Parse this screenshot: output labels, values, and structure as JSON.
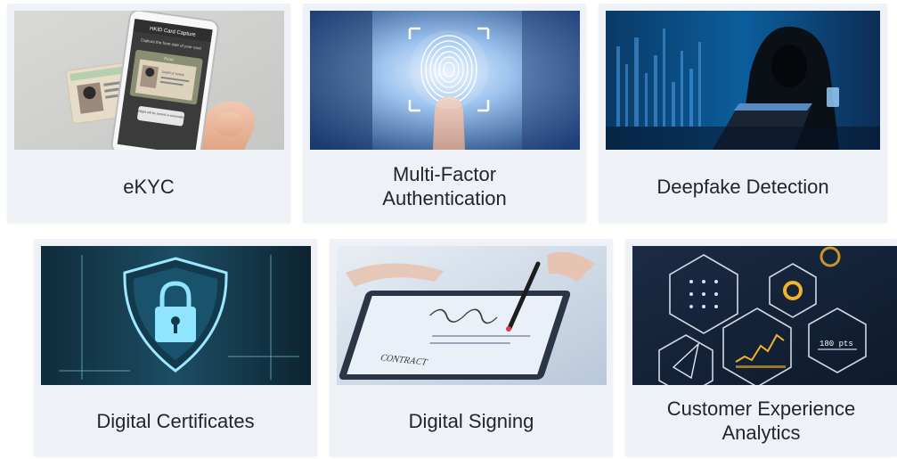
{
  "cards": [
    {
      "title": "eKYC",
      "image": "phone-id-card-capture-image",
      "mock": {
        "screen_title": "HKID Card Capture",
        "screen_hint": "Capture the front side of your card",
        "screen_tag": "Front",
        "screen_btn": "Highlight will be turned in automatically",
        "card_name": "SAMPLE NAME"
      }
    },
    {
      "title": "Multi-Factor\nAuthentication",
      "image": "fingerprint-scan-image"
    },
    {
      "title": "Deepfake Detection",
      "image": "hooded-hacker-laptop-image"
    },
    {
      "title": "Digital Certificates",
      "image": "padlock-shield-image"
    },
    {
      "title": "Digital Signing",
      "image": "contract-tablet-signing-image",
      "mock": {
        "doc_text": "CONTRACT"
      }
    },
    {
      "title": "Customer Experience\nAnalytics",
      "image": "hexagon-analytics-dashboard-image",
      "mock": {
        "pts_text": "180 pts"
      }
    }
  ],
  "colors": {
    "card_bg": "#eef1f6",
    "text": "#1f2430",
    "accent_blue": "#2a86d6",
    "accent_gold": "#f0b428"
  }
}
